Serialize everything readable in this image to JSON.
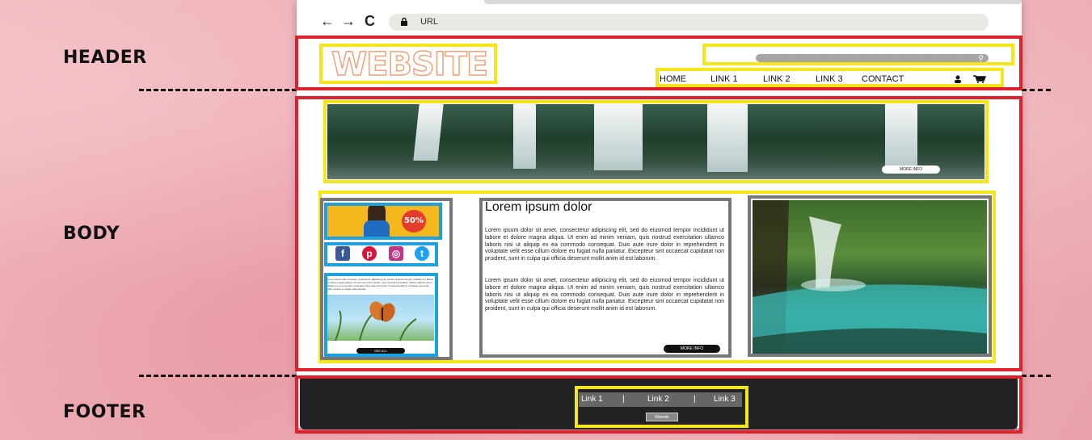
{
  "labels": {
    "header": "HEADER",
    "body": "BODY",
    "footer": "FOOTER"
  },
  "browser": {
    "url": "URL",
    "nav_back": "←",
    "nav_forward": "→",
    "nav_reload": "C"
  },
  "header": {
    "logo": "WEBSITE",
    "nav": [
      "HOME",
      "LINK 1",
      "LINK 2",
      "LINK 3",
      "CONTACT"
    ]
  },
  "hero": {
    "button": "MORE INFO"
  },
  "sidebar": {
    "promo_badge": "50%",
    "social": [
      "f",
      "p",
      "◎",
      "t"
    ],
    "blog_text": "Lorem ipsum dolor sit amet, consectetur adipiscing elit, sed do eiusmod tempor incididunt ut labore et dolore magna aliqua. Ut enim ad minim veniam, quis nostrud exercitation ullamco laboris nisi ut aliquip ex ea commodo consequat. Duis aute irure dolor in reprehenderit in voluptate velit esse cillum dolore eu fugiat nulla pariatur.",
    "blog_button": "SEE ALL"
  },
  "article": {
    "title": "Lorem ipsum dolor",
    "paragraph_1": "Lorem ipsum dolor sit amet, consectetur adipiscing elit, sed do eiusmod tempor incididunt ut labore et dolore magna aliqua. Ut enim ad minim veniam, quis nostrud exercitation ullamco laboris nisi ut aliquip ex ea commodo consequat. Duis aute irure dolor in reprehenderit in voluptate velit esse cillum dolore eu fugiat nulla pariatur. Excepteur sint occaecat cupidatat non proident, sunt in culpa qui officia deserunt mollit anim id est laborum.",
    "paragraph_2": "Lorem ipsum dolor sit amet, consectetur adipiscing elit, sed do eiusmod tempor incididunt ut labore et dolore magna aliqua. Ut enim ad minim veniam, quis nostrud exercitation ullamco laboris nisi ut aliquip ex ea commodo consequat. Duis aute irure dolor in reprehenderit in voluptate velit esse cillum dolore eu fugiat nulla pariatur. Excepteur sint occaecat cupidatat non proident, sunt in culpa qui officia deserunt mollit anim id est laborum.",
    "button": "MORE INFO"
  },
  "footer": {
    "links": [
      "Link 1",
      "Link 2",
      "Link 3"
    ],
    "site": "Website"
  },
  "colors": {
    "region_red": "#e0202a",
    "element_yellow": "#f5e61a",
    "content_grey": "#777777",
    "sidebar_blue": "#1ea0dc"
  }
}
